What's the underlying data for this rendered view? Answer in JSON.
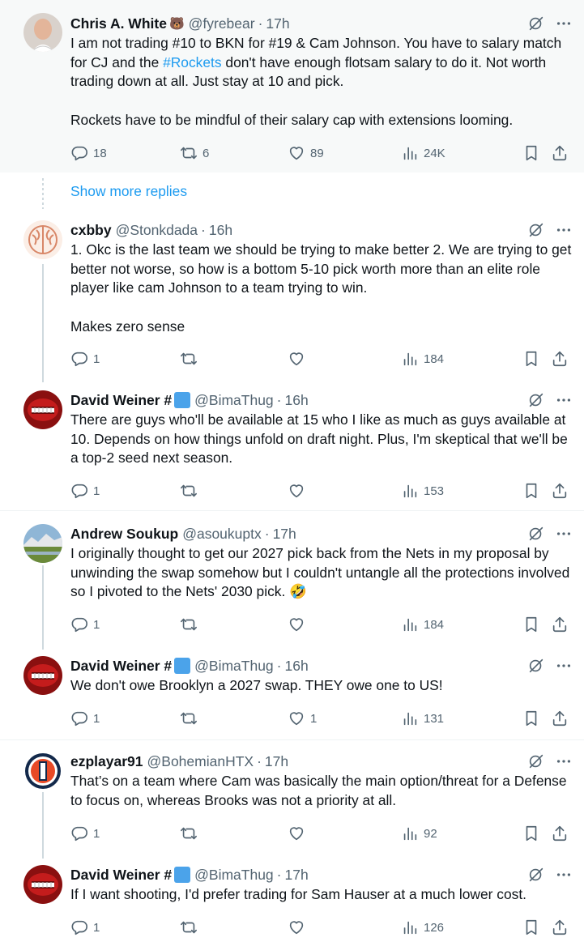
{
  "show_more_replies": "Show more replies",
  "tweets": [
    {
      "name": "Chris A. White",
      "emoji": "🐻",
      "handle": "@fyrebear",
      "time": "17h",
      "paragraphs": [
        [
          "I am not trading #10 to BKN for #19 & Cam Johnson. You have to salary match for CJ and the ",
          "#Rockets",
          " don't have enough flotsam salary to do it. Not worth trading down at all. Just stay at 10 and pick."
        ],
        "Rockets have to be mindful of their salary cap with extensions looming."
      ],
      "replies": "18",
      "reposts": "6",
      "likes": "89",
      "views": "24K"
    },
    {
      "name": "cxbby",
      "handle": "@Stonkdada",
      "time": "16h",
      "paragraphs": [
        "1. Okc is the last team we should be trying to make better 2. We are trying to get better not worse, so how is a bottom 5-10 pick worth more than an elite role player like cam Johnson to a team trying to win.",
        "Makes zero sense"
      ],
      "replies": "1",
      "reposts": "",
      "likes": "",
      "views": "184"
    },
    {
      "name": "David Weiner #",
      "handle": "@BimaThug",
      "time": "16h",
      "paragraphs": [
        "There are guys who'll be available at 15 who I like as much as guys available at 10. Depends on how things unfold on draft night. Plus, I'm skeptical that we'll be a top-2 seed next season."
      ],
      "replies": "1",
      "reposts": "",
      "likes": "",
      "views": "153"
    },
    {
      "name": "Andrew Soukup",
      "handle": "@asoukuptx",
      "time": "17h",
      "paragraphs": [
        "I originally thought to get our 2027 pick back from the Nets in my proposal by unwinding the swap somehow but I couldn't untangle all the protections involved so I pivoted to the Nets' 2030 pick. 🤣"
      ],
      "replies": "1",
      "reposts": "",
      "likes": "",
      "views": "184"
    },
    {
      "name": "David Weiner #",
      "handle": "@BimaThug",
      "time": "16h",
      "paragraphs": [
        "We don't owe Brooklyn a 2027 swap. THEY owe one to US!"
      ],
      "replies": "1",
      "reposts": "",
      "likes": "1",
      "views": "131"
    },
    {
      "name": "ezplayar91",
      "handle": "@BohemianHTX",
      "time": "17h",
      "paragraphs": [
        "That’s on a team where Cam was basically the main option/threat for a Defense to focus on, whereas Brooks was not a priority at all."
      ],
      "replies": "1",
      "reposts": "",
      "likes": "",
      "views": "92"
    },
    {
      "name": "David Weiner #",
      "handle": "@BimaThug",
      "time": "17h",
      "paragraphs": [
        "If I want shooting, I'd prefer trading for Sam Hauser at a much lower cost."
      ],
      "replies": "1",
      "reposts": "",
      "likes": "",
      "views": "126"
    }
  ]
}
